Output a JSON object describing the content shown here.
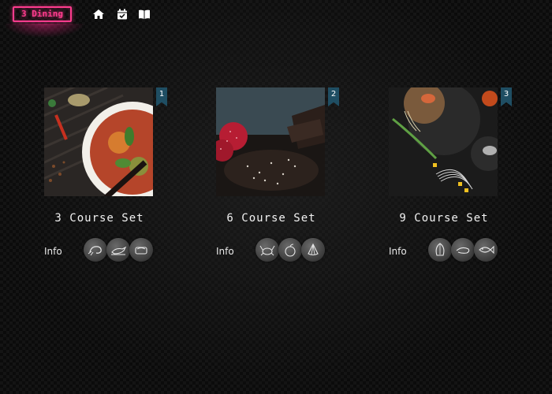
{
  "header": {
    "logo_text": "3 Dining",
    "nav_icons": [
      "home-icon",
      "calendar-check-icon",
      "book-icon"
    ]
  },
  "cards": [
    {
      "badge": "1",
      "title": "3 Course Set",
      "info_label": "Info",
      "dish_icons": [
        "shrimp-icon",
        "bird-icon",
        "dish-icon"
      ]
    },
    {
      "badge": "2",
      "title": "6 Course Set",
      "info_label": "Info",
      "dish_icons": [
        "crab-icon",
        "fruit-icon",
        "shell-icon"
      ]
    },
    {
      "badge": "3",
      "title": "9 Course Set",
      "info_label": "Info",
      "dish_icons": [
        "shell-icon",
        "shrimp-icon",
        "fish-icon"
      ]
    }
  ],
  "colors": {
    "accent_neon": "#ff3c8e",
    "badge_bg": "#1f4e63",
    "background": "#0b0b0b"
  }
}
